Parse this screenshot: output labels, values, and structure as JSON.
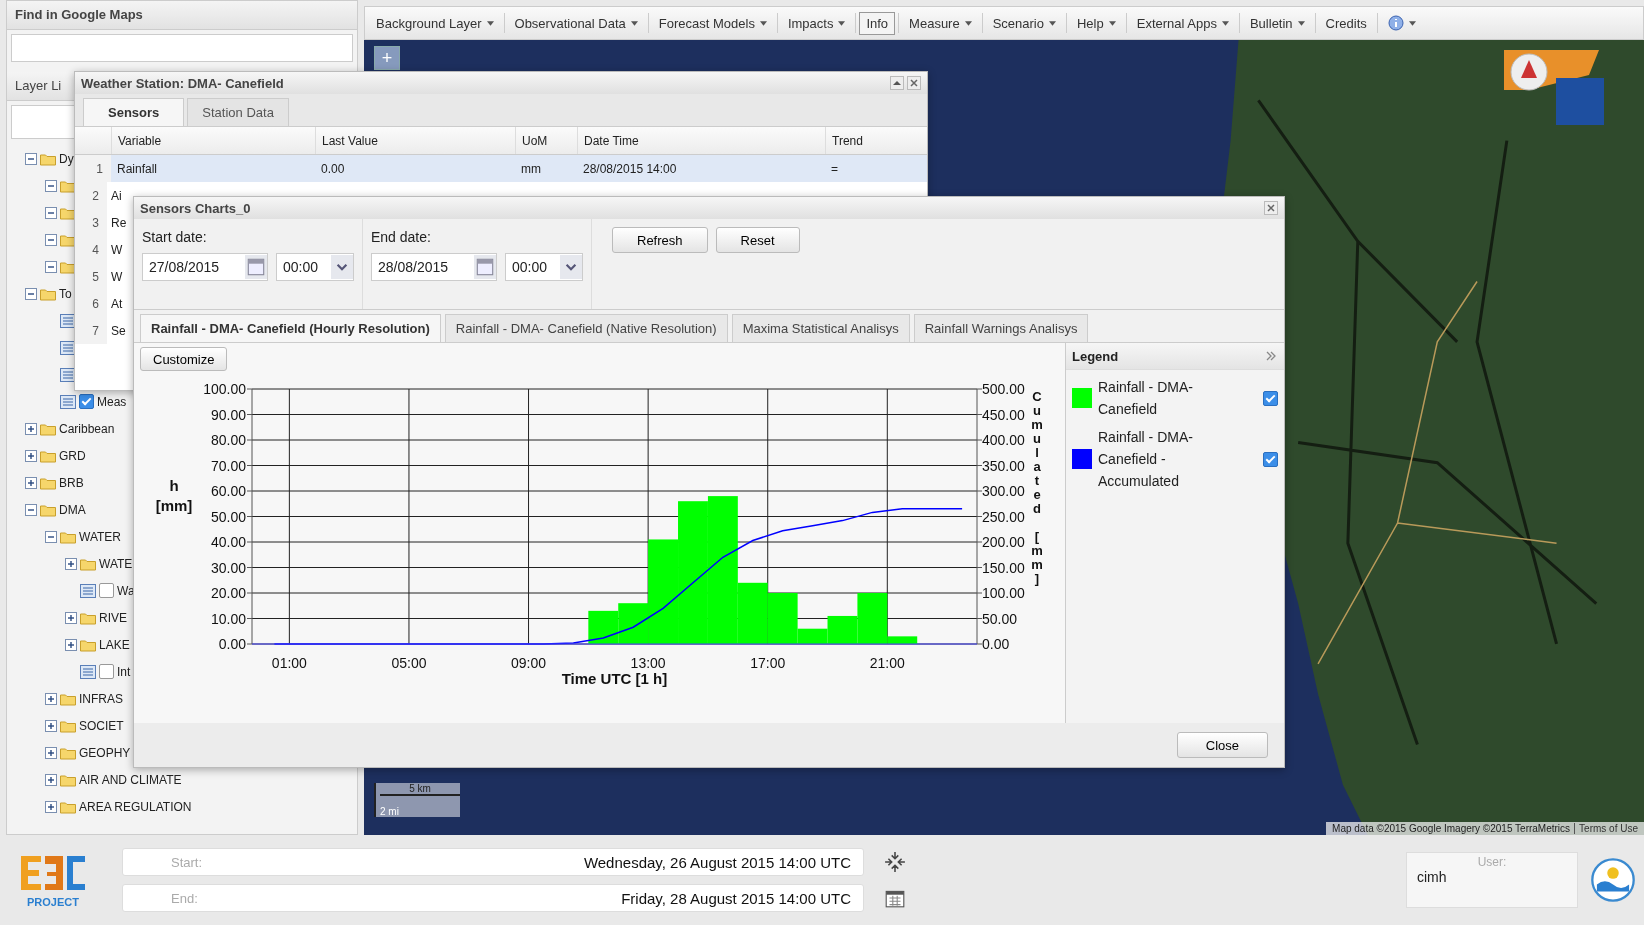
{
  "left_panel": {
    "search": {
      "title": "Find in Google Maps"
    },
    "layer_list": {
      "title": "Layer Li",
      "items": [
        {
          "kind": "folder",
          "label": "Dy",
          "expanded": true,
          "children": [
            {
              "kind": "folder",
              "expanded": true
            },
            {
              "kind": "folder",
              "expanded": true
            },
            {
              "kind": "folder",
              "expanded": true
            },
            {
              "kind": "folder",
              "expanded": true
            }
          ]
        },
        {
          "kind": "folder",
          "label": "To",
          "expanded": true,
          "children": [
            {
              "kind": "layer"
            },
            {
              "kind": "layer"
            },
            {
              "kind": "layer"
            },
            {
              "kind": "layer",
              "label": "Meas",
              "checked": true
            }
          ]
        },
        {
          "kind": "folder",
          "label": "Caribbean",
          "expanded": false
        },
        {
          "kind": "folder",
          "label": "GRD",
          "expanded": false
        },
        {
          "kind": "folder",
          "label": "BRB",
          "expanded": false
        },
        {
          "kind": "folder",
          "label": "DMA",
          "expanded": true,
          "children": [
            {
              "kind": "folder",
              "label": "WATER",
              "expanded": true,
              "children": [
                {
                  "kind": "folder",
                  "label": "WATE",
                  "expanded": false
                },
                {
                  "kind": "layer",
                  "label": "Wa",
                  "checked": false
                },
                {
                  "kind": "folder",
                  "label": "RIVE",
                  "expanded": false
                },
                {
                  "kind": "folder",
                  "label": "LAKE",
                  "expanded": false
                },
                {
                  "kind": "layer",
                  "label": "Int",
                  "checked": false
                }
              ]
            },
            {
              "kind": "folder",
              "label": "INFRAS",
              "expanded": false
            },
            {
              "kind": "folder",
              "label": "SOCIET",
              "expanded": false
            },
            {
              "kind": "folder",
              "label": "GEOPHY",
              "expanded": false
            },
            {
              "kind": "folder",
              "label": "AIR AND CLIMATE",
              "expanded": false
            },
            {
              "kind": "folder",
              "label": "AREA REGULATION",
              "expanded": false
            }
          ]
        }
      ]
    }
  },
  "menu_bar": [
    {
      "kind": "text",
      "label": "Background Layer",
      "has_menu": true,
      "selected": false
    },
    {
      "kind": "text",
      "label": "Observational Data",
      "has_menu": true,
      "selected": false
    },
    {
      "kind": "text",
      "label": "Forecast Models",
      "has_menu": true,
      "selected": false
    },
    {
      "kind": "text",
      "label": "Impacts",
      "has_menu": true,
      "selected": false
    },
    {
      "kind": "text",
      "label": "Info",
      "has_menu": false,
      "selected": true
    },
    {
      "kind": "text",
      "label": "Measure",
      "has_menu": true,
      "selected": false
    },
    {
      "kind": "text",
      "label": "Scenario",
      "has_menu": true,
      "selected": false
    },
    {
      "kind": "text",
      "label": "Help",
      "has_menu": true,
      "selected": false
    },
    {
      "kind": "text",
      "label": "External Apps",
      "has_menu": true,
      "selected": false
    },
    {
      "kind": "text",
      "label": "Bulletin",
      "has_menu": true,
      "selected": false
    },
    {
      "kind": "text",
      "label": "Credits",
      "has_menu": false,
      "selected": false
    },
    {
      "kind": "icon",
      "has_menu": true,
      "selected": false
    }
  ],
  "map": {
    "zoom_in": "+",
    "scale": {
      "metric": "5 km",
      "imperial": "2 mi"
    },
    "attribution": "Map data ©2015 Google Imagery ©2015 TerraMetrics",
    "terms_link": "Terms of Use"
  },
  "station_window": {
    "title": "Weather Station: DMA- Canefield",
    "tabs": [
      {
        "label": "Sensors",
        "selected": true
      },
      {
        "label": "Station Data",
        "selected": false
      }
    ],
    "columns": [
      "Variable",
      "Last Value",
      "UoM",
      "Date Time",
      "Trend"
    ],
    "rows": [
      {
        "num": "1",
        "variable": "Rainfall",
        "last_value": "0.00",
        "uom": "mm",
        "date_time": "28/08/2015 14:00",
        "trend": "=",
        "selected": true
      },
      {
        "num": "2",
        "variable": "Ai",
        "selected": false
      },
      {
        "num": "3",
        "variable": "Re",
        "selected": false
      },
      {
        "num": "4",
        "variable": "W",
        "selected": false
      },
      {
        "num": "5",
        "variable": "W",
        "selected": false
      },
      {
        "num": "6",
        "variable": "At",
        "selected": false
      },
      {
        "num": "7",
        "variable": "Se",
        "selected": false
      }
    ]
  },
  "charts_window": {
    "title": "Sensors Charts_0",
    "start_date": {
      "label": "Start date:",
      "date": "27/08/2015",
      "time": "00:00"
    },
    "end_date": {
      "label": "End date:",
      "date": "28/08/2015",
      "time": "00:00"
    },
    "buttons": [
      "Refresh",
      "Reset"
    ],
    "tabs": [
      {
        "label": "Rainfall - DMA- Canefield (Hourly Resolution)",
        "selected": true
      },
      {
        "label": "Rainfall - DMA- Canefield (Native Resolution)",
        "selected": false
      },
      {
        "label": "Maxima Statistical Analisys",
        "selected": false
      },
      {
        "label": "Rainfall Warnings Analisys",
        "selected": false
      }
    ],
    "customize": "Customize",
    "chart_data": {
      "type": "bar",
      "grid": true,
      "xlabel": "Time UTC [1 h]",
      "ylabel": "h [mm]",
      "y2label": "Cumulated [mm]",
      "x": [
        0.5,
        1.5,
        2.5,
        3.5,
        4.5,
        5.5,
        6.5,
        7.5,
        8.5,
        9.5,
        10.5,
        11.5,
        12.5,
        13.5,
        14.5,
        15.5,
        16.5,
        17.5,
        18.5,
        19.5,
        20.5,
        21.5,
        22.5,
        23.5
      ],
      "series": [
        {
          "name": "Rainfall - DMA- Canefield",
          "color": "#00ff00",
          "values": [
            0,
            0,
            0,
            0,
            0,
            0,
            0,
            0,
            0,
            0,
            0,
            13,
            16,
            41,
            56,
            58,
            24,
            20,
            6,
            11,
            20,
            3,
            0,
            0
          ]
        },
        {
          "name": "Rainfall - DMA- Canefield - Accumulated",
          "color": "#0000ff",
          "type": "line",
          "axis": "y2",
          "values": [
            0,
            0,
            0,
            0,
            0,
            0,
            0,
            0,
            0,
            0,
            2,
            12,
            33,
            70,
            120,
            170,
            203,
            222,
            232,
            242,
            258,
            265,
            265,
            265
          ]
        }
      ],
      "xlim": [
        -0.25,
        24
      ],
      "ylim": [
        0,
        100
      ],
      "y2lim": [
        0,
        500
      ],
      "xticks": [
        {
          "value": 1,
          "label": "01:00"
        },
        {
          "value": 5,
          "label": "05:00"
        },
        {
          "value": 9,
          "label": "09:00"
        },
        {
          "value": 13,
          "label": "13:00"
        },
        {
          "value": 17,
          "label": "17:00"
        },
        {
          "value": 21,
          "label": "21:00"
        }
      ],
      "yticks": [
        {
          "value": 0,
          "label": "0.00"
        },
        {
          "value": 10,
          "label": "10.00"
        },
        {
          "value": 20,
          "label": "20.00"
        },
        {
          "value": 30,
          "label": "30.00"
        },
        {
          "value": 40,
          "label": "40.00"
        },
        {
          "value": 50,
          "label": "50.00"
        },
        {
          "value": 60,
          "label": "60.00"
        },
        {
          "value": 70,
          "label": "70.00"
        },
        {
          "value": 80,
          "label": "80.00"
        },
        {
          "value": 90,
          "label": "90.00"
        },
        {
          "value": 100,
          "label": "100.00"
        }
      ],
      "y2ticks": [
        {
          "value": 0,
          "label": "0.00"
        },
        {
          "value": 50,
          "label": "50.00"
        },
        {
          "value": 100,
          "label": "100.00"
        },
        {
          "value": 150,
          "label": "150.00"
        },
        {
          "value": 200,
          "label": "200.00"
        },
        {
          "value": 250,
          "label": "250.00"
        },
        {
          "value": 300,
          "label": "300.00"
        },
        {
          "value": 350,
          "label": "350.00"
        },
        {
          "value": 400,
          "label": "400.00"
        },
        {
          "value": 450,
          "label": "450.00"
        },
        {
          "value": 500,
          "label": "500.00"
        }
      ]
    },
    "legend": {
      "title": "Legend",
      "items": [
        {
          "checked": true
        },
        {
          "checked": true
        }
      ]
    },
    "close": "Close"
  },
  "bottom_bar": {
    "logo_text": "PROJECT",
    "start": {
      "label": "Start:",
      "value": "Wednesday, 26 August 2015 14:00 UTC"
    },
    "end": {
      "label": "End:",
      "value": "Friday, 28 August 2015 14:00 UTC"
    },
    "user": {
      "label": "User:",
      "value": "cimh"
    }
  }
}
